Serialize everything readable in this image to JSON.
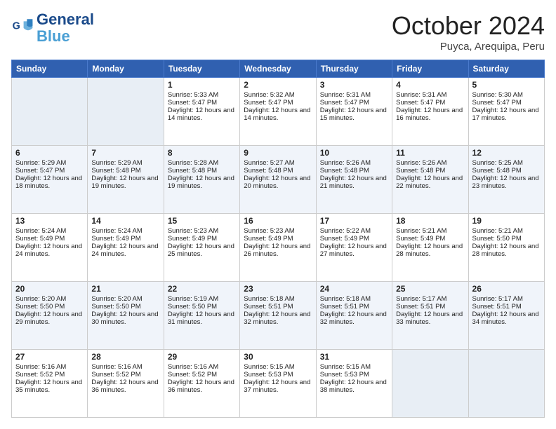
{
  "header": {
    "logo_line1": "General",
    "logo_line2": "Blue",
    "month": "October 2024",
    "location": "Puyca, Arequipa, Peru"
  },
  "columns": [
    "Sunday",
    "Monday",
    "Tuesday",
    "Wednesday",
    "Thursday",
    "Friday",
    "Saturday"
  ],
  "weeks": [
    [
      {
        "day": "",
        "info": ""
      },
      {
        "day": "",
        "info": ""
      },
      {
        "day": "1",
        "info": "Sunrise: 5:33 AM\nSunset: 5:47 PM\nDaylight: 12 hours and 14 minutes."
      },
      {
        "day": "2",
        "info": "Sunrise: 5:32 AM\nSunset: 5:47 PM\nDaylight: 12 hours and 14 minutes."
      },
      {
        "day": "3",
        "info": "Sunrise: 5:31 AM\nSunset: 5:47 PM\nDaylight: 12 hours and 15 minutes."
      },
      {
        "day": "4",
        "info": "Sunrise: 5:31 AM\nSunset: 5:47 PM\nDaylight: 12 hours and 16 minutes."
      },
      {
        "day": "5",
        "info": "Sunrise: 5:30 AM\nSunset: 5:47 PM\nDaylight: 12 hours and 17 minutes."
      }
    ],
    [
      {
        "day": "6",
        "info": "Sunrise: 5:29 AM\nSunset: 5:47 PM\nDaylight: 12 hours and 18 minutes."
      },
      {
        "day": "7",
        "info": "Sunrise: 5:29 AM\nSunset: 5:48 PM\nDaylight: 12 hours and 19 minutes."
      },
      {
        "day": "8",
        "info": "Sunrise: 5:28 AM\nSunset: 5:48 PM\nDaylight: 12 hours and 19 minutes."
      },
      {
        "day": "9",
        "info": "Sunrise: 5:27 AM\nSunset: 5:48 PM\nDaylight: 12 hours and 20 minutes."
      },
      {
        "day": "10",
        "info": "Sunrise: 5:26 AM\nSunset: 5:48 PM\nDaylight: 12 hours and 21 minutes."
      },
      {
        "day": "11",
        "info": "Sunrise: 5:26 AM\nSunset: 5:48 PM\nDaylight: 12 hours and 22 minutes."
      },
      {
        "day": "12",
        "info": "Sunrise: 5:25 AM\nSunset: 5:48 PM\nDaylight: 12 hours and 23 minutes."
      }
    ],
    [
      {
        "day": "13",
        "info": "Sunrise: 5:24 AM\nSunset: 5:49 PM\nDaylight: 12 hours and 24 minutes."
      },
      {
        "day": "14",
        "info": "Sunrise: 5:24 AM\nSunset: 5:49 PM\nDaylight: 12 hours and 24 minutes."
      },
      {
        "day": "15",
        "info": "Sunrise: 5:23 AM\nSunset: 5:49 PM\nDaylight: 12 hours and 25 minutes."
      },
      {
        "day": "16",
        "info": "Sunrise: 5:23 AM\nSunset: 5:49 PM\nDaylight: 12 hours and 26 minutes."
      },
      {
        "day": "17",
        "info": "Sunrise: 5:22 AM\nSunset: 5:49 PM\nDaylight: 12 hours and 27 minutes."
      },
      {
        "day": "18",
        "info": "Sunrise: 5:21 AM\nSunset: 5:49 PM\nDaylight: 12 hours and 28 minutes."
      },
      {
        "day": "19",
        "info": "Sunrise: 5:21 AM\nSunset: 5:50 PM\nDaylight: 12 hours and 28 minutes."
      }
    ],
    [
      {
        "day": "20",
        "info": "Sunrise: 5:20 AM\nSunset: 5:50 PM\nDaylight: 12 hours and 29 minutes."
      },
      {
        "day": "21",
        "info": "Sunrise: 5:20 AM\nSunset: 5:50 PM\nDaylight: 12 hours and 30 minutes."
      },
      {
        "day": "22",
        "info": "Sunrise: 5:19 AM\nSunset: 5:50 PM\nDaylight: 12 hours and 31 minutes."
      },
      {
        "day": "23",
        "info": "Sunrise: 5:18 AM\nSunset: 5:51 PM\nDaylight: 12 hours and 32 minutes."
      },
      {
        "day": "24",
        "info": "Sunrise: 5:18 AM\nSunset: 5:51 PM\nDaylight: 12 hours and 32 minutes."
      },
      {
        "day": "25",
        "info": "Sunrise: 5:17 AM\nSunset: 5:51 PM\nDaylight: 12 hours and 33 minutes."
      },
      {
        "day": "26",
        "info": "Sunrise: 5:17 AM\nSunset: 5:51 PM\nDaylight: 12 hours and 34 minutes."
      }
    ],
    [
      {
        "day": "27",
        "info": "Sunrise: 5:16 AM\nSunset: 5:52 PM\nDaylight: 12 hours and 35 minutes."
      },
      {
        "day": "28",
        "info": "Sunrise: 5:16 AM\nSunset: 5:52 PM\nDaylight: 12 hours and 36 minutes."
      },
      {
        "day": "29",
        "info": "Sunrise: 5:16 AM\nSunset: 5:52 PM\nDaylight: 12 hours and 36 minutes."
      },
      {
        "day": "30",
        "info": "Sunrise: 5:15 AM\nSunset: 5:53 PM\nDaylight: 12 hours and 37 minutes."
      },
      {
        "day": "31",
        "info": "Sunrise: 5:15 AM\nSunset: 5:53 PM\nDaylight: 12 hours and 38 minutes."
      },
      {
        "day": "",
        "info": ""
      },
      {
        "day": "",
        "info": ""
      }
    ]
  ]
}
